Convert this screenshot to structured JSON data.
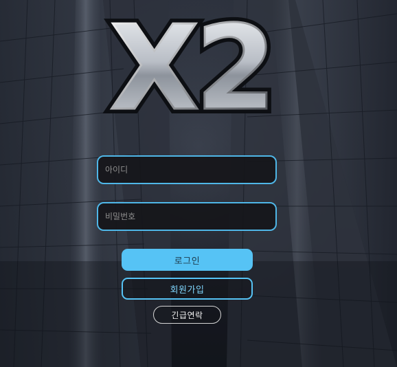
{
  "logo": {
    "text": "X2"
  },
  "form": {
    "id_placeholder": "아이디",
    "password_placeholder": "비밀번호"
  },
  "buttons": {
    "login_label": "로그인",
    "register_label": "회원가입",
    "contact_label": "긴급연락"
  },
  "colors": {
    "accent": "#56c3f5",
    "field_border": "#4fb7e8",
    "background": "#1b1f28"
  }
}
